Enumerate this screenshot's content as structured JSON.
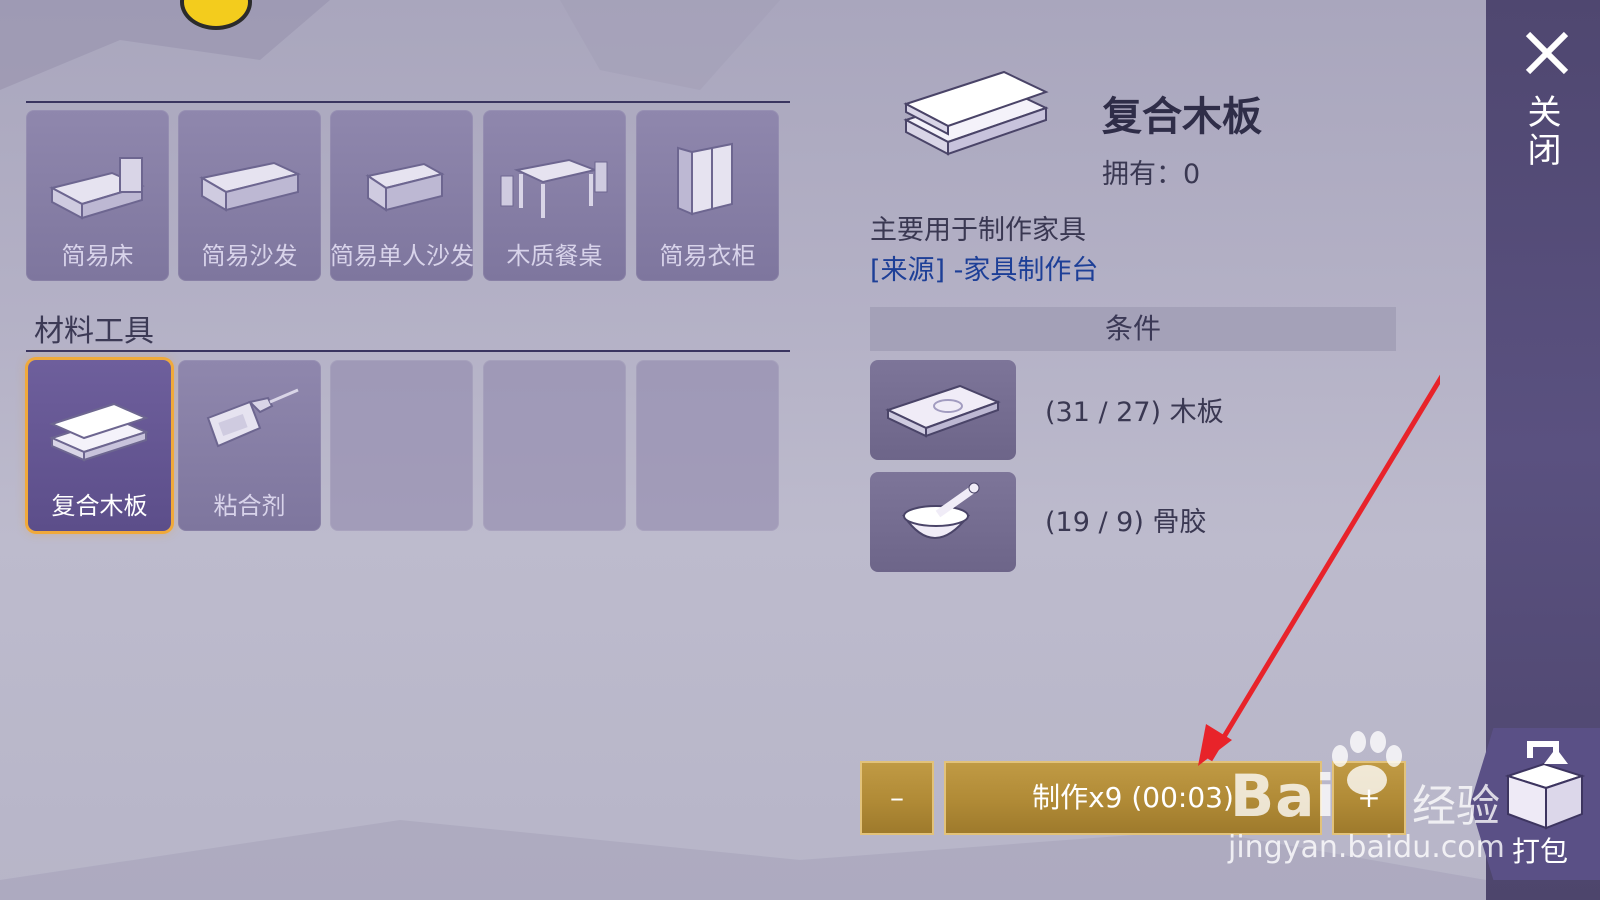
{
  "furniture": {
    "items": [
      {
        "label": "简易床",
        "icon": "bed-icon"
      },
      {
        "label": "简易沙发",
        "icon": "sofa-icon"
      },
      {
        "label": "简易单人沙发",
        "icon": "armchair-icon"
      },
      {
        "label": "木质餐桌",
        "icon": "dining-table-icon"
      },
      {
        "label": "简易衣柜",
        "icon": "wardrobe-icon"
      }
    ]
  },
  "materials": {
    "title": "材料工具",
    "items": [
      {
        "label": "复合木板",
        "icon": "composite-board-icon",
        "selected": true
      },
      {
        "label": "粘合剂",
        "icon": "glue-bottle-icon"
      }
    ]
  },
  "detail": {
    "name": "复合木板",
    "owned": "拥有：0",
    "description": "主要用于制作家具",
    "source": "[来源] -家具制作台",
    "conditions_title": "条件",
    "conditions": [
      {
        "text": "(31 / 27) 木板",
        "icon": "wood-plank-icon"
      },
      {
        "text": "(19 / 9) 骨胶",
        "icon": "bone-glue-icon"
      }
    ]
  },
  "actions": {
    "minus": "–",
    "craft": "制作x9 (00:03)",
    "plus": "+"
  },
  "side": {
    "close": "关闭",
    "pack": "打包"
  },
  "watermark": {
    "brand": "Bai",
    "cn": "经验",
    "url": "jingyan.baidu.com"
  },
  "colors": {
    "selected_border": "#f0a93a",
    "button_gold": "#b08a36",
    "side_panel": "#524a75",
    "source_link": "#1d3f97",
    "arrow": "#e8232a"
  }
}
